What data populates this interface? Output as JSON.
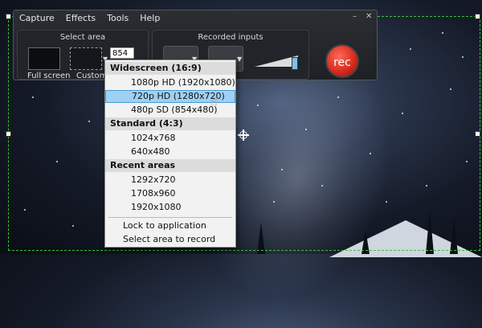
{
  "menu": [
    "Capture",
    "Effects",
    "Tools",
    "Help"
  ],
  "window_controls": {
    "minimize": "–",
    "close": "✕"
  },
  "select_area": {
    "title": "Select area",
    "fullscreen_label": "Full screen",
    "custom_label": "Custom",
    "width_value": "854"
  },
  "recorded_inputs": {
    "title": "Recorded inputs"
  },
  "rec_button": {
    "label": "rec",
    "color": "#d4281a"
  },
  "dropdown": {
    "widescreen_header": "Widescreen (16:9)",
    "widescreen": [
      "1080p HD (1920x1080)",
      "720p HD (1280x720)",
      "480p SD (854x480)"
    ],
    "highlighted": "720p HD (1280x720)",
    "standard_header": "Standard (4:3)",
    "standard": [
      "1024x768",
      "640x480"
    ],
    "recent_header": "Recent areas",
    "recent": [
      "1292x720",
      "1708x960",
      "1920x1080"
    ],
    "actions": [
      "Lock to application",
      "Select area to record"
    ]
  },
  "colors": {
    "selection_border": "#3bbf3b",
    "highlight": "#9fd0f3"
  },
  "icons": {
    "cursor": "hand-pointer-icon",
    "crosshair": "crosshair-icon"
  }
}
